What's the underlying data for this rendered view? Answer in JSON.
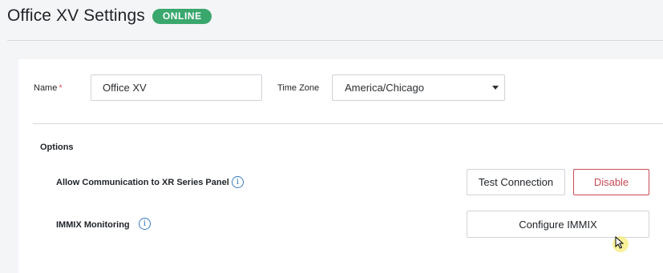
{
  "header": {
    "title": "Office XV Settings",
    "status_badge": "ONLINE"
  },
  "form": {
    "name_label": "Name",
    "name_required_marker": "*",
    "name_value": "Office XV",
    "timezone_label": "Time Zone",
    "timezone_value": "America/Chicago"
  },
  "options": {
    "section_title": "Options",
    "items": [
      {
        "label": "Allow Communication to XR Series Panel",
        "info_icon": "info-icon",
        "buttons": [
          {
            "label": "Test Connection",
            "style": "default"
          },
          {
            "label": "Disable",
            "style": "danger"
          }
        ]
      },
      {
        "label": "IMMIX Monitoring",
        "info_icon": "info-icon",
        "buttons": [
          {
            "label": "Configure IMMIX",
            "style": "default"
          }
        ]
      }
    ]
  },
  "colors": {
    "badge_green": "#3aa76d",
    "danger_red": "#c94b57",
    "info_blue": "#3b7bbf",
    "page_bg": "#f4f5f7"
  }
}
